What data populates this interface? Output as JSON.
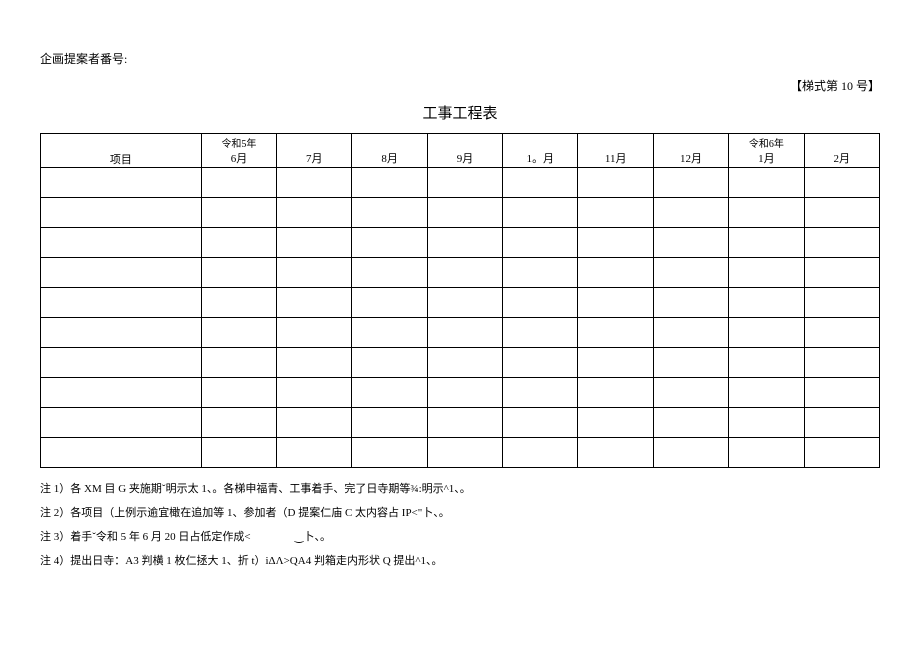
{
  "header": {
    "proposer_label": "企画提案者番号:",
    "form_number": "【梯式第 10 号】"
  },
  "title": "工事工程表",
  "table": {
    "item_header": "项目",
    "year_labels": {
      "reiwa5": "令和5年",
      "reiwa6": "令和6年"
    },
    "months": [
      "6月",
      "7月",
      "8月",
      "9月",
      "1。月",
      "11月",
      "12月",
      "1月",
      "2月"
    ],
    "row_count": 10
  },
  "notes": [
    "注 1）各 XM 目 G 夹施期ˇ明示太 1、。各梯申福青、工事着手、完了日寺期等¾:明示^1、。",
    "注 2）各项目（上例示逾宜橄在追加等 1、参加者（D 提案仁庙 C 太内容占 IP<\"卜、。",
    "注 3）着手ˇ令和 5 年 6 月 20 日占低定作成<                ‿卜、。",
    "注 4）提出日寺：A3 判横 1 枚仁拯大 1、折 t）iΔΛ>QA4 判箱走内形状 Q 提出^1、。"
  ]
}
